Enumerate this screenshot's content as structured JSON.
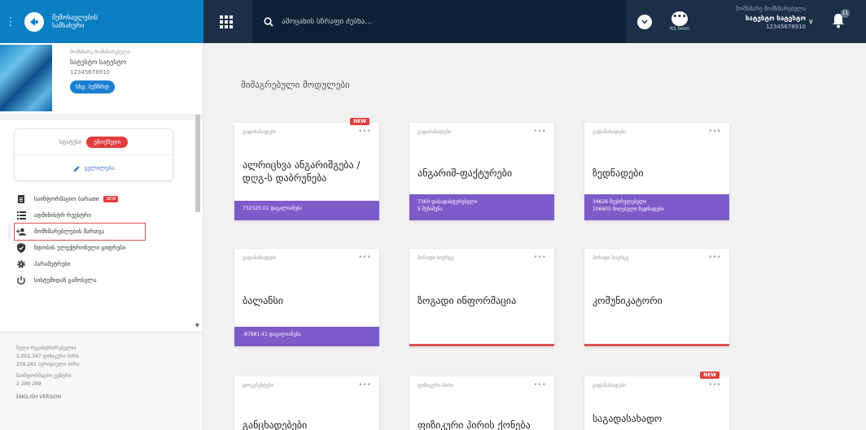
{
  "header": {
    "brand_line1": "შემოსავლების",
    "brand_line2": "სამსახური",
    "search_placeholder": "ამოცანის სწრაფი ძებნა...",
    "rs_label": "RS ნიიო",
    "user_small": "მომხმარე მომხმარებელი",
    "user_name": "სატესტო სატესტო",
    "user_id": "12345678910",
    "bell_count": "11"
  },
  "profile": {
    "small": "მომხმარე მომხმარებელი",
    "name": "სატესტო სატესტო",
    "id": "12345678910",
    "more_label": "სხვ. ბუნზრდ"
  },
  "status": {
    "label": "სტატუსი",
    "value": "ემოქმედი",
    "edit_label": "ცვლილება"
  },
  "nav": [
    {
      "label": "საინფორმაციო ბარათი",
      "badge": "NEW"
    },
    {
      "label": "ადმინისტრ რეესტრი",
      "badge": ""
    },
    {
      "label": "მომხმარებლების მართვა",
      "badge": ""
    },
    {
      "label": "ნდობის ელექტრონული ციფრები",
      "badge": ""
    },
    {
      "label": "პარამეტრები",
      "badge": ""
    },
    {
      "label": "სისტემიდან გამოსვლა",
      "badge": ""
    }
  ],
  "footer": {
    "line1": "ნელი რეგისტრირებულია",
    "stat1_num": "1,002,347",
    "stat1_label": "ფიზიკური პირი",
    "stat2_num": "259,241",
    "stat2_label": "იურიდიული პირი",
    "line2": "საინფორმაციო ცენტრი",
    "phone": "2 299 299",
    "english": "ENGLISH VERSION"
  },
  "main": {
    "title": "მიმაგრებული მოდულები",
    "cards": [
      {
        "category": "გადასახადები",
        "title": "ალრიცხვა ანგარიშგება / დღგ-ს დაბრუნება",
        "footer1": "732325.01 დავალიანება",
        "footer2": "",
        "new": "NEW"
      },
      {
        "category": "გადასახადები",
        "title": "ანგარიშ-ფაქტურები",
        "footer1": "7360 დასადასტურებელი",
        "footer2": "5 შენიშვნა",
        "new": ""
      },
      {
        "category": "გადასახადები",
        "title": "ზედნადები",
        "footer1": "34626 შეუსრულებელი",
        "footer2": "106605 მიღებული ზედნადები",
        "new": ""
      },
      {
        "category": "გადასახადები",
        "title": "ბალანსი",
        "footer1": "-87881.41 დავალიანება",
        "footer2": "",
        "new": ""
      },
      {
        "category": "პირადი სივრცე",
        "title": "ზოგადი ინფორმაცია",
        "footer1": "",
        "footer2": "",
        "new": ""
      },
      {
        "category": "პირადი სივრცე",
        "title": "კომუნიკატორი",
        "footer1": "",
        "footer2": "",
        "new": ""
      },
      {
        "category": "დოკუმენტები",
        "title": "განცხადებები",
        "footer1": "",
        "footer2": "",
        "new": ""
      },
      {
        "category": "ფიზიკური პირი",
        "title": "ფიზიკური პირის ქონება",
        "footer1": "",
        "footer2": "",
        "new": ""
      },
      {
        "category": "გადასახადები",
        "title": "საგადასახადო",
        "footer1": "",
        "footer2": "",
        "new": "NEW"
      }
    ]
  }
}
